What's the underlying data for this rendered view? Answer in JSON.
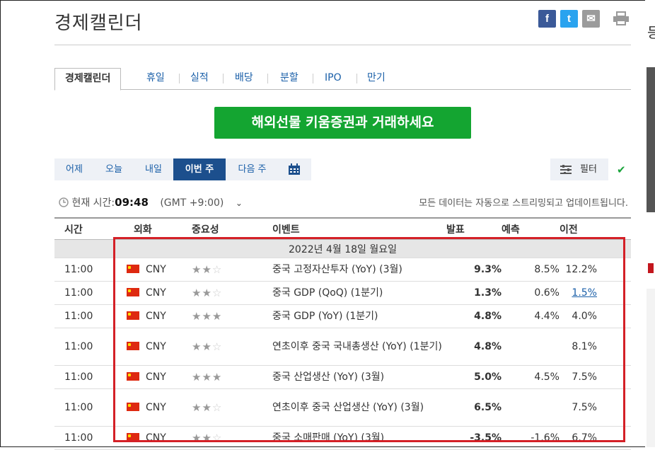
{
  "page_title": "경제캘린더",
  "share": {
    "facebook": "f",
    "twitter": "t",
    "mail": "✉"
  },
  "tabs": [
    "경제캘린더",
    "휴일",
    "실적",
    "배당",
    "분할",
    "IPO",
    "만기"
  ],
  "promo_button": "해외선물 키움증권과 거래하세요",
  "day_buttons": [
    "어제",
    "오늘",
    "내일",
    "이번 주",
    "다음 주"
  ],
  "filter_label": "필터",
  "current_time_label": "현재 시간:",
  "current_time": "09:48",
  "timezone": "(GMT +9:00)",
  "streaming_note": "모든 데이터는 자동으로 스트리밍되고 업데이트됩니다.",
  "columns": [
    "시간",
    "외화",
    "중요성",
    "이벤트",
    "발표",
    "예측",
    "이전"
  ],
  "date_header": "2022년 4월 18일 월요일",
  "rows": [
    {
      "time": "11:00",
      "currency": "CNY",
      "stars": 2,
      "event": "중국 고정자산투자 (YoY) (3월)",
      "actual": "9.3%",
      "actual_color": "red",
      "forecast": "8.5%",
      "previous": "12.2%",
      "revised": false
    },
    {
      "time": "11:00",
      "currency": "CNY",
      "stars": 2,
      "event": "중국 GDP (QoQ) (1분기)",
      "actual": "1.3%",
      "actual_color": "red",
      "forecast": "0.6%",
      "previous": "1.5%",
      "revised": true
    },
    {
      "time": "11:00",
      "currency": "CNY",
      "stars": 3,
      "event": "중국 GDP (YoY) (1분기)",
      "actual": "4.8%",
      "actual_color": "red",
      "forecast": "4.4%",
      "previous": "4.0%",
      "revised": false
    },
    {
      "time": "11:00",
      "currency": "CNY",
      "stars": 2,
      "event": "연초이후 중국 국내총생산 (YoY) (1분기)",
      "actual": "4.8%",
      "actual_color": "black",
      "forecast": "",
      "previous": "8.1%",
      "revised": false
    },
    {
      "time": "11:00",
      "currency": "CNY",
      "stars": 3,
      "event": "중국 산업생산 (YoY) (3월)",
      "actual": "5.0%",
      "actual_color": "red",
      "forecast": "4.5%",
      "previous": "7.5%",
      "revised": false
    },
    {
      "time": "11:00",
      "currency": "CNY",
      "stars": 2,
      "event": "연초이후 중국 산업생산 (YoY) (3월)",
      "actual": "6.5%",
      "actual_color": "black",
      "forecast": "",
      "previous": "7.5%",
      "revised": false
    },
    {
      "time": "11:00",
      "currency": "CNY",
      "stars": 2,
      "event": "중국 소매판매 (YoY) (3월)",
      "actual": "-3.5%",
      "actual_color": "blue",
      "forecast": "-1.6%",
      "previous": "6.7%",
      "revised": false
    }
  ],
  "colors": {
    "highlight_box": "#d42027",
    "active_tab": "#1c4f8d",
    "promo": "#14a531",
    "positive": "#c3161d",
    "negative": "#1a5fa8"
  }
}
